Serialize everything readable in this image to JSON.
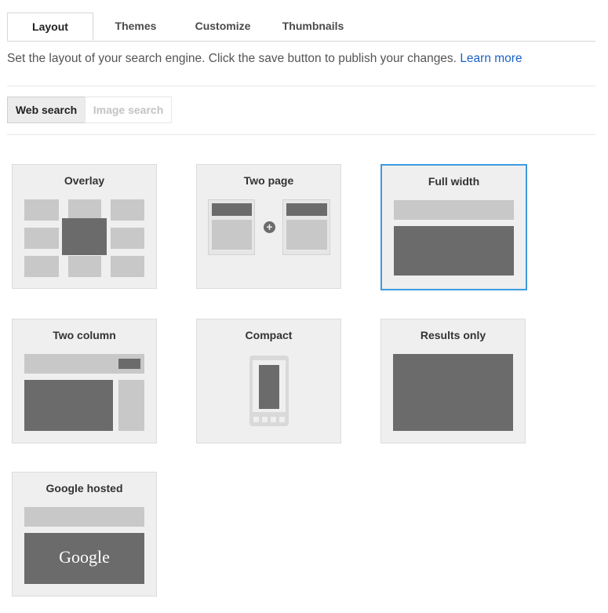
{
  "tabs": [
    {
      "label": "Layout",
      "active": true
    },
    {
      "label": "Themes",
      "active": false
    },
    {
      "label": "Customize",
      "active": false
    },
    {
      "label": "Thumbnails",
      "active": false
    }
  ],
  "description": {
    "text": "Set the layout of your search engine. Click the save button to publish your changes.",
    "link": "Learn more"
  },
  "search_type": {
    "web": "Web search",
    "image": "Image search",
    "selected": "Web search"
  },
  "layouts": [
    {
      "title": "Overlay"
    },
    {
      "title": "Two page"
    },
    {
      "title": "Full width",
      "selected": true
    },
    {
      "title": "Two column"
    },
    {
      "title": "Compact"
    },
    {
      "title": "Results only"
    },
    {
      "title": "Google hosted"
    }
  ],
  "google_hosted_logo": "Google",
  "colors": {
    "selected_border": "#3d9ae0",
    "link": "#1a62c6",
    "preview_dark": "#6b6b6b",
    "preview_light": "#c8c8c8"
  }
}
